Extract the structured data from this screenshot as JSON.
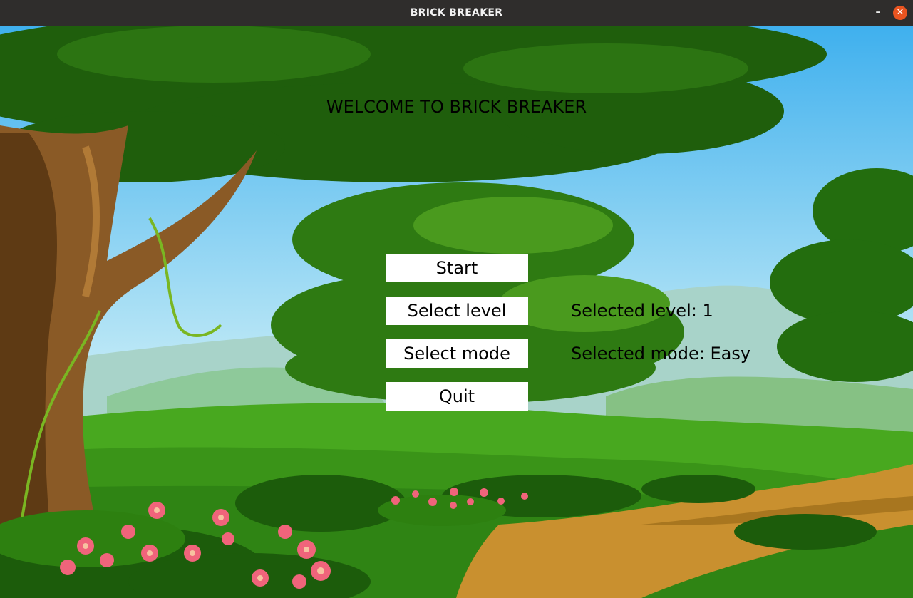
{
  "window": {
    "title": "BRICK BREAKER",
    "minimize_glyph": "–",
    "close_glyph": "✕",
    "close_color": "#e95420"
  },
  "menu": {
    "heading": "WELCOME TO BRICK BREAKER",
    "start_label": "Start",
    "select_level_label": "Select level",
    "select_mode_label": "Select mode",
    "quit_label": "Quit"
  },
  "status": {
    "selected_level": "Selected level: 1",
    "selected_mode": "Selected mode: Easy"
  },
  "background": {
    "description_icons": [
      "tree-icon",
      "bush-icon",
      "flower-icon",
      "dirt-path",
      "mountain"
    ],
    "sky_top": "#45b6ef",
    "sky_bottom": "#c5ecf5",
    "grass": "#3e9a18",
    "path": "#c9902f"
  }
}
